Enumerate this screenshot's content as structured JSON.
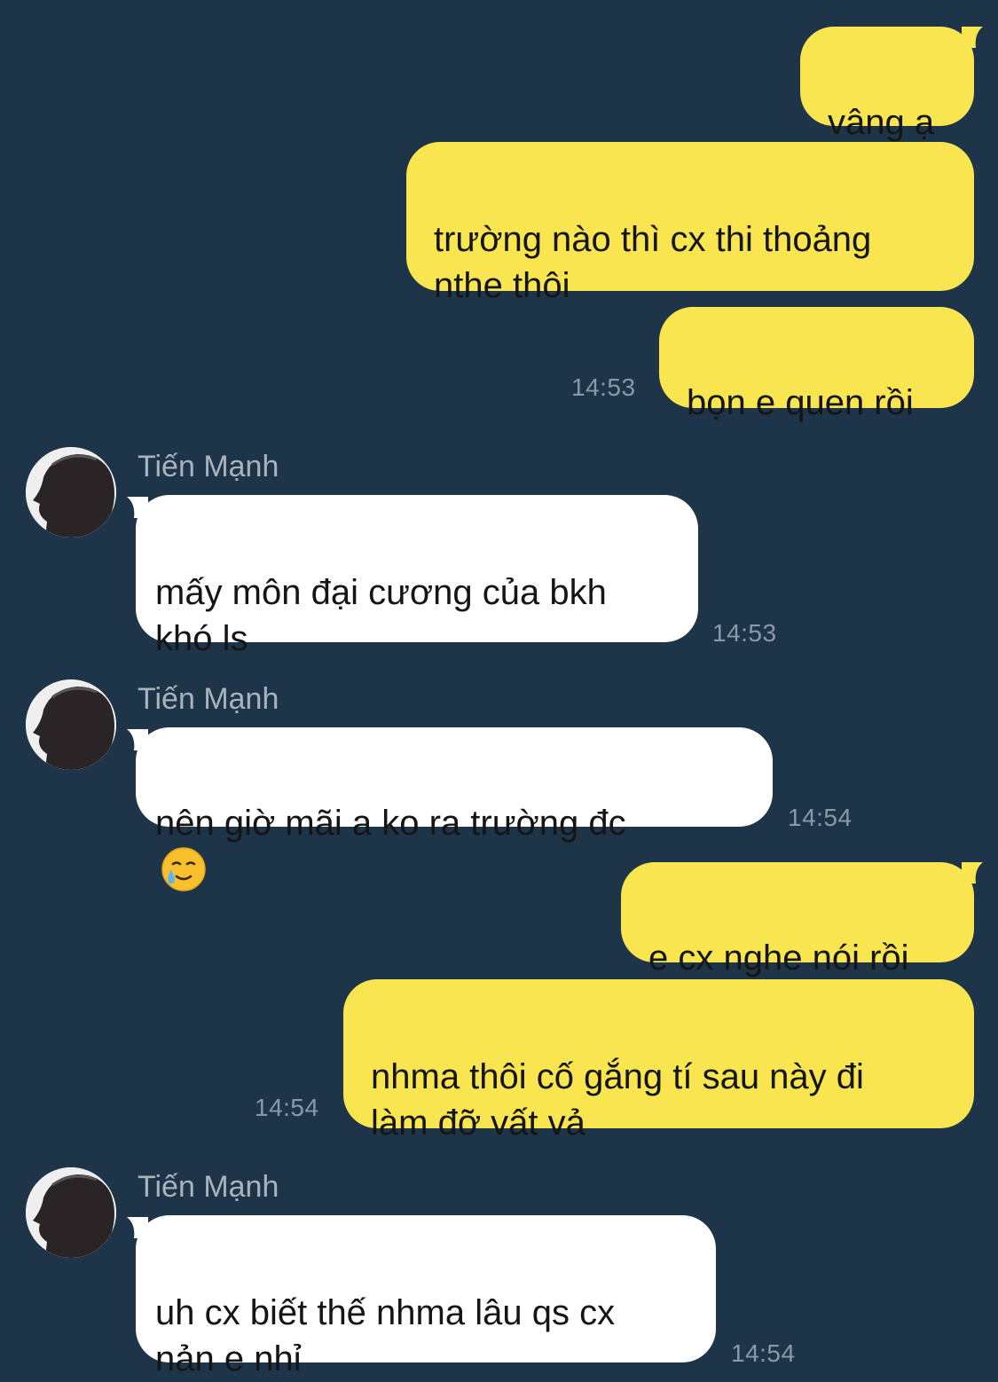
{
  "messages": [
    {
      "text": "vâng ạ"
    },
    {
      "text": "trường nào thì cx thi thoảng\nnthe thôi"
    },
    {
      "text": "bọn e quen rồi",
      "time": "14:53"
    },
    {
      "sender": "Tiến Mạnh",
      "text": "mấy môn đại cương của bkh\nkhó ls",
      "time": "14:53"
    },
    {
      "sender": "Tiến Mạnh",
      "text": "nên giờ mãi a ko ra trường đc",
      "emoji": "crying-smile-emoji",
      "time": "14:54"
    },
    {
      "text": "e cx nghe nói rồi"
    },
    {
      "text": "nhma thôi cố gắng tí sau này đi\nlàm đỡ vất vả",
      "time": "14:54"
    },
    {
      "sender": "Tiến Mạnh",
      "text": "uh cx biết thế nhma lâu qs cx\nnản e nhỉ",
      "time": "14:54"
    }
  ],
  "colors": {
    "background": "#1e3549",
    "outgoing_bubble": "#f8e54f",
    "incoming_bubble": "#ffffff",
    "timestamp": "#8b99a6",
    "sender_name": "#a9b3bc"
  }
}
